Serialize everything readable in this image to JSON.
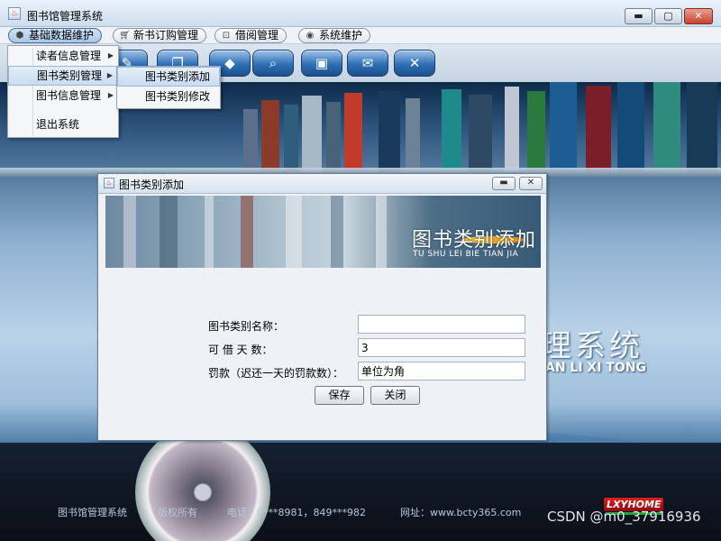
{
  "window": {
    "title": "图书馆管理系统",
    "controls": {
      "minimize": "▬",
      "maximize": "▢",
      "close": "✕"
    }
  },
  "menubar": [
    {
      "label": "基础数据维护",
      "icon": "cube-icon"
    },
    {
      "label": "新书订购管理",
      "icon": "cart-icon"
    },
    {
      "label": "借阅管理",
      "icon": "lock-icon"
    },
    {
      "label": "系统维护",
      "icon": "disc-icon"
    }
  ],
  "toolbar": {
    "buttons": [
      {
        "icon": "book-icon",
        "glyph": "✎"
      },
      {
        "icon": "open-book-icon",
        "glyph": "❐"
      },
      {
        "icon": "diamond-icon",
        "glyph": "◆"
      },
      {
        "icon": "search-icon",
        "glyph": "⌕"
      },
      {
        "icon": "monitor-icon",
        "glyph": "▣"
      },
      {
        "icon": "card-icon",
        "glyph": "✉"
      },
      {
        "icon": "exit-icon",
        "glyph": "✕"
      }
    ]
  },
  "main_menu": {
    "items": [
      {
        "label": "读者信息管理",
        "has_submenu": true
      },
      {
        "label": "图书类别管理",
        "has_submenu": true
      },
      {
        "label": "图书信息管理",
        "has_submenu": true
      },
      {
        "label": "退出系统",
        "has_submenu": false
      }
    ]
  },
  "submenu": {
    "items": [
      {
        "label": "图书类别添加"
      },
      {
        "label": "图书类别修改"
      }
    ]
  },
  "background": {
    "title": "理系统",
    "pinyin": "AN LI XI TONG",
    "footer": {
      "name": "图书馆管理系统",
      "copyright": "版权所有",
      "phone": "电话：8***8981，849***982",
      "website": "网址：www.bcty365.com"
    },
    "logo": "LXYHOME"
  },
  "dialog": {
    "title": "图书类别添加",
    "banner_title": "图书类别添加",
    "banner_pinyin": "TU SHU LEI BIE TIAN JIA",
    "controls": {
      "minimize": "▬",
      "close": "✕"
    },
    "fields": [
      {
        "label": "图书类别名称：",
        "value": ""
      },
      {
        "label": "可 借 天 数：",
        "value": "3"
      },
      {
        "label": "罚款（迟还一天的罚款数）：",
        "value": "单位为角"
      }
    ],
    "buttons": {
      "save": "保存",
      "close": "关闭"
    }
  },
  "watermark": "CSDN @m0_37916936"
}
